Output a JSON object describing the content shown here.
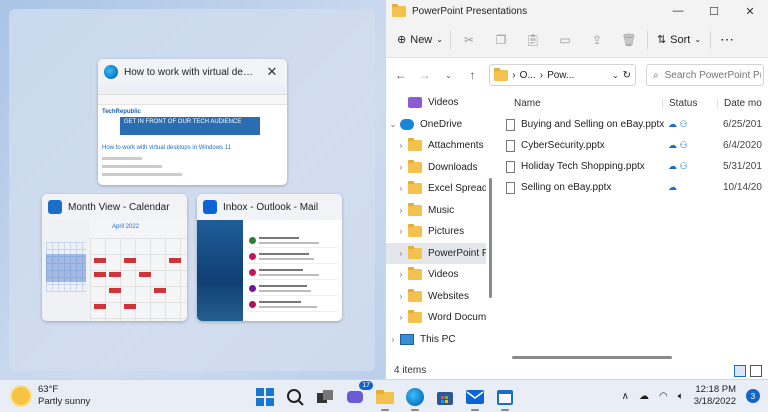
{
  "snap": {
    "edge": {
      "title": "How to work with virtual desktops i...",
      "close": "✕",
      "article_heading": "How to work with virtual desktops in Windows 11",
      "ad_text": "GET IN FRONT OF OUR TECH AUDIENCE"
    },
    "calendar": {
      "title": "Month View - Calendar",
      "month": "April 2022"
    },
    "mail": {
      "title": "Inbox - Outlook - Mail"
    }
  },
  "explorer": {
    "title": "PowerPoint Presentations",
    "controls": {
      "minimize": "—",
      "maximize": "☐",
      "close": "✕"
    },
    "toolbar": {
      "new_label": "New",
      "sort_label": "Sort",
      "more": "⋯"
    },
    "address": {
      "part1": "O...",
      "sep": "›",
      "part2": "Pow..."
    },
    "search_placeholder": "Search PowerPoint Pre...",
    "nav": [
      {
        "label": "Videos",
        "icon": "video-icon",
        "expand": "",
        "indent": 1
      },
      {
        "label": "OneDrive",
        "icon": "onedrive-icon",
        "expand": "v",
        "indent": 0
      },
      {
        "label": "Attachments",
        "icon": "folder-icon",
        "expand": ">",
        "indent": 1
      },
      {
        "label": "Downloads",
        "icon": "folder-icon",
        "expand": ">",
        "indent": 1
      },
      {
        "label": "Excel Spreadshe",
        "icon": "folder-icon",
        "expand": ">",
        "indent": 1
      },
      {
        "label": "Music",
        "icon": "folder-icon",
        "expand": ">",
        "indent": 1
      },
      {
        "label": "Pictures",
        "icon": "folder-icon",
        "expand": ">",
        "indent": 1
      },
      {
        "label": "PowerPoint Pre",
        "icon": "folder-icon",
        "expand": ">",
        "indent": 1,
        "selected": true
      },
      {
        "label": "Videos",
        "icon": "folder-icon",
        "expand": ">",
        "indent": 1
      },
      {
        "label": "Websites",
        "icon": "folder-icon",
        "expand": ">",
        "indent": 1
      },
      {
        "label": "Word Documen",
        "icon": "folder-icon",
        "expand": ">",
        "indent": 1
      },
      {
        "label": "This PC",
        "icon": "pc-icon",
        "expand": ">",
        "indent": 0
      }
    ],
    "columns": {
      "name": "Name",
      "status": "Status",
      "date": "Date mo"
    },
    "files": [
      {
        "name": "Buying and Selling on eBay.pptx",
        "status": "☁ ⚇",
        "date": "6/25/201"
      },
      {
        "name": "CyberSecurity.pptx",
        "status": "☁ ⚇",
        "date": "6/4/2020"
      },
      {
        "name": "Holiday Tech Shopping.pptx",
        "status": "☁ ⚇",
        "date": "5/31/201"
      },
      {
        "name": "Selling on eBay.pptx",
        "status": "☁",
        "date": "10/14/20"
      }
    ],
    "status_count": "4 items"
  },
  "taskbar": {
    "temp": "63°F",
    "condition": "Partly sunny",
    "chat_badge": "17",
    "time": "12:18 PM",
    "date": "3/18/2022",
    "notifications": "3"
  }
}
